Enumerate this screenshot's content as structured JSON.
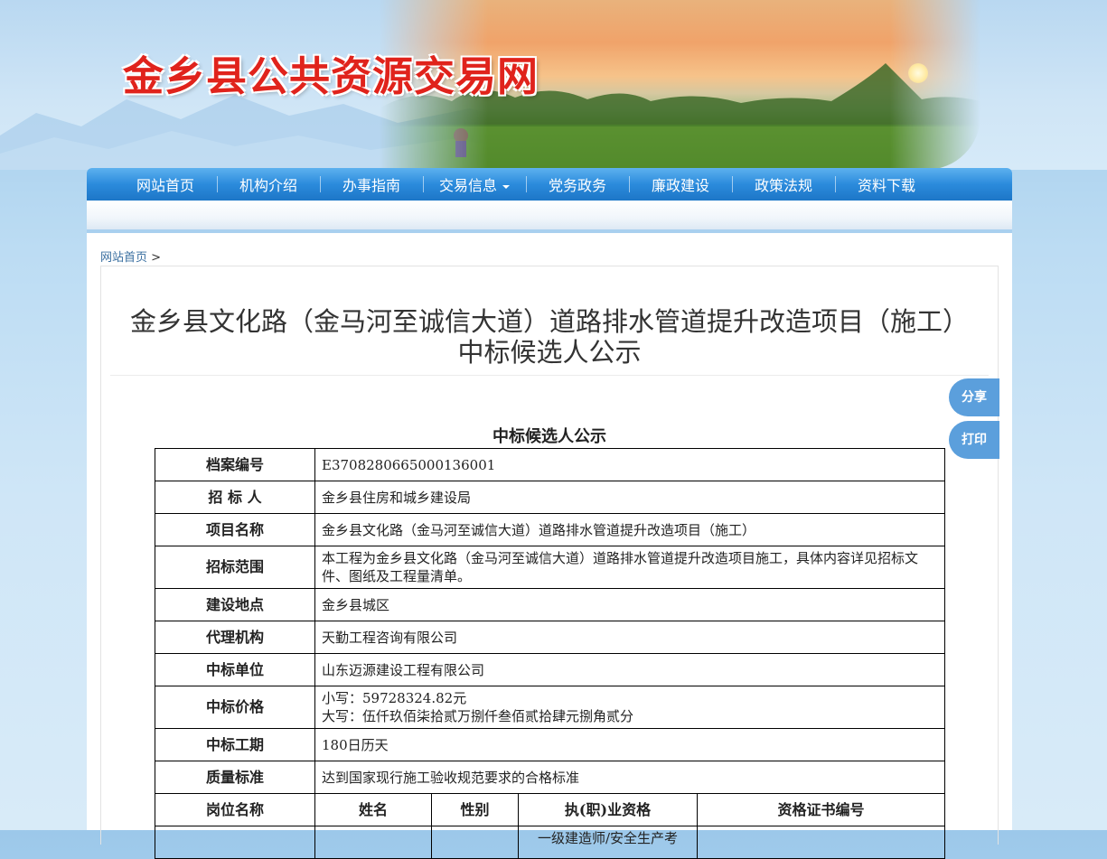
{
  "site": {
    "title": "金乡县公共资源交易网"
  },
  "nav": {
    "items": [
      {
        "label": "网站首页"
      },
      {
        "label": "机构介绍"
      },
      {
        "label": "办事指南"
      },
      {
        "label": "交易信息"
      },
      {
        "label": "党务政务"
      },
      {
        "label": "廉政建设"
      },
      {
        "label": "政策法规"
      },
      {
        "label": "资料下载"
      }
    ]
  },
  "breadcrumb": {
    "home": "网站首页",
    "separator": ">"
  },
  "article": {
    "title_line1": "金乡县文化路（金马河至诚信大道）道路排水管道提升改造项目（施工）",
    "title_line2": "中标候选人公示"
  },
  "side": {
    "share": "分享",
    "print": "打印"
  },
  "notice": {
    "heading": "中标候选人公示",
    "rows": [
      {
        "label": "档案编号",
        "value": "E3708280665000136001"
      },
      {
        "label": "招 标 人",
        "value": "金乡县住房和城乡建设局"
      },
      {
        "label": "项目名称",
        "value": "金乡县文化路（金马河至诚信大道）道路排水管道提升改造项目（施工）"
      },
      {
        "label": "招标范围",
        "value": "本工程为金乡县文化路（金马河至诚信大道）道路排水管道提升改造项目施工，具体内容详见招标文件、图纸及工程量清单。"
      },
      {
        "label": "建设地点",
        "value": "金乡县城区"
      },
      {
        "label": "代理机构",
        "value": "天勤工程咨询有限公司"
      },
      {
        "label": "中标单位",
        "value": "山东迈源建设工程有限公司"
      },
      {
        "label": "中标价格",
        "value": "小写：59728324.82元",
        "value2": "大写：伍仟玖佰柒拾贰万捌仟叁佰贰拾肆元捌角贰分"
      },
      {
        "label": "中标工期",
        "value": "180日历天"
      },
      {
        "label": "质量标准",
        "value": "达到国家现行施工验收规范要求的合格标准"
      }
    ],
    "staff_headers": [
      "岗位名称",
      "姓名",
      "性别",
      "执(职)业资格",
      "资格证书编号"
    ],
    "staff_partial": "一级建造师/安全生产考"
  }
}
